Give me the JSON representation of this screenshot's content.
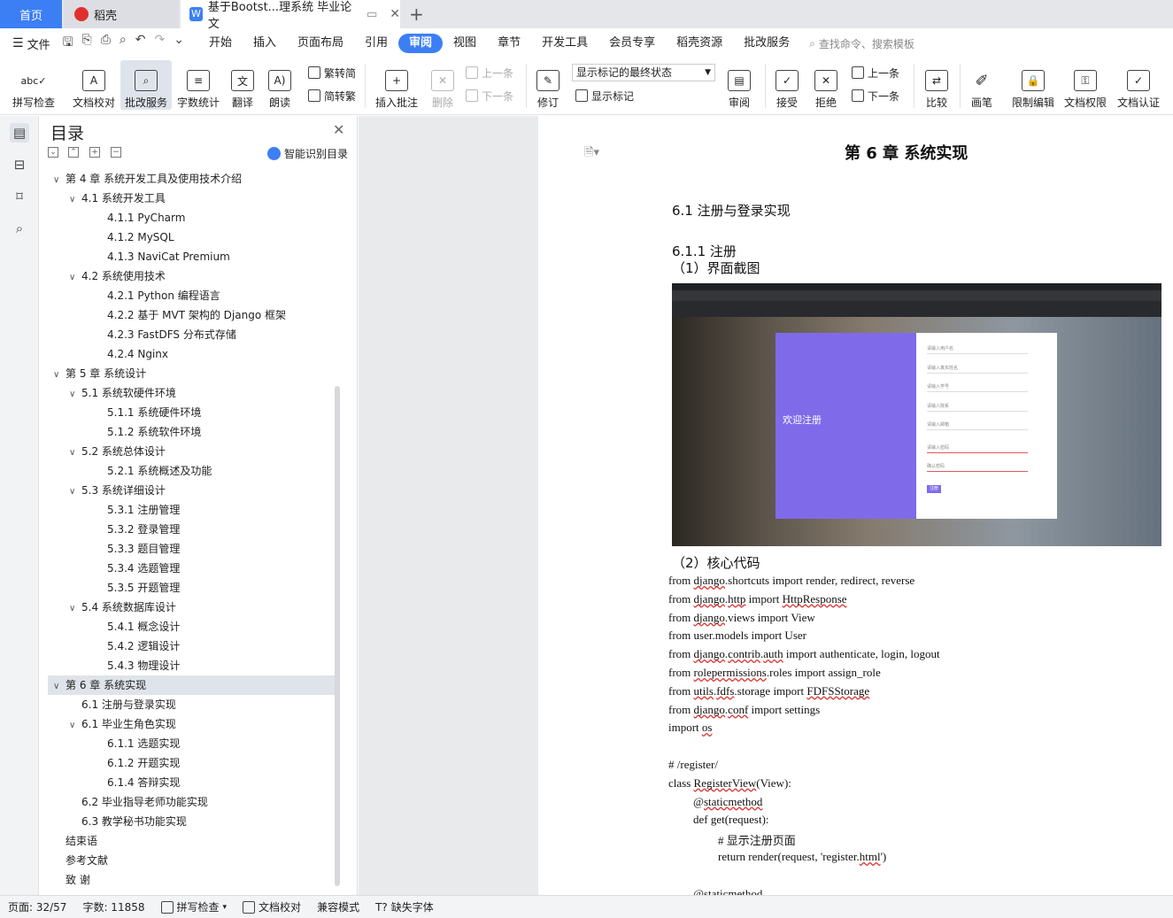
{
  "tabs": {
    "home": "首页",
    "docer": "稻壳",
    "doc": "基于Bootst...理系统 毕业论文"
  },
  "menu": {
    "file": "文件",
    "items": [
      "开始",
      "插入",
      "页面布局",
      "引用",
      "审阅",
      "视图",
      "章节",
      "开发工具",
      "会员专享",
      "稻壳资源",
      "批改服务"
    ],
    "active": "审阅",
    "search": "查找命令、搜索模板"
  },
  "ribbon": {
    "spell": "拼写检查",
    "proof": "文档校对",
    "review_service": "批改服务",
    "wordcount": "字数统计",
    "translate": "翻译",
    "read": "朗读",
    "trad": "繁转简",
    "simp": "简转繁",
    "insert_comment": "插入批注",
    "delete": "删除",
    "prev": "上一条",
    "next": "下一条",
    "track": "修订",
    "markup_state": "显示标记的最终状态",
    "show_markup": "显示标记",
    "review": "审阅",
    "accept": "接受",
    "reject": "拒绝",
    "prev2": "上一条",
    "next2": "下一条",
    "compare": "比较",
    "pen": "画笔",
    "restrict": "限制编辑",
    "perm": "文档权限",
    "cert": "文档认证"
  },
  "toc": {
    "title": "目录",
    "smart": "智能识别目录",
    "items": [
      {
        "t": "第 4 章  系统开发工具及使用技术介绍",
        "l": 0,
        "a": "v"
      },
      {
        "t": "4.1  系统开发工具",
        "l": 1,
        "a": "v"
      },
      {
        "t": "4.1.1 PyCharm",
        "l": 2,
        "a": ""
      },
      {
        "t": "4.1.2 MySQL",
        "l": 2,
        "a": ""
      },
      {
        "t": "4.1.3 NaviCat Premium",
        "l": 2,
        "a": ""
      },
      {
        "t": "4.2  系统使用技术",
        "l": 1,
        "a": "v"
      },
      {
        "t": "4.2.1 Python 编程语言",
        "l": 2,
        "a": ""
      },
      {
        "t": "4.2.2 基于 MVT 架构的 Django 框架",
        "l": 2,
        "a": ""
      },
      {
        "t": "4.2.3 FastDFS 分布式存储",
        "l": 2,
        "a": ""
      },
      {
        "t": "4.2.4 Nginx",
        "l": 2,
        "a": ""
      },
      {
        "t": "第 5 章  系统设计",
        "l": 0,
        "a": "v"
      },
      {
        "t": "5.1 系统软硬件环境",
        "l": 1,
        "a": "v"
      },
      {
        "t": "5.1.1  系统硬件环境",
        "l": 2,
        "a": ""
      },
      {
        "t": "5.1.2  系统软件环境",
        "l": 2,
        "a": ""
      },
      {
        "t": "5.2 系统总体设计",
        "l": 1,
        "a": "v"
      },
      {
        "t": "5.2.1 系统概述及功能",
        "l": 2,
        "a": ""
      },
      {
        "t": "5.3 系统详细设计",
        "l": 1,
        "a": "v"
      },
      {
        "t": "5.3.1  注册管理",
        "l": 2,
        "a": ""
      },
      {
        "t": "5.3.2  登录管理",
        "l": 2,
        "a": ""
      },
      {
        "t": "5.3.3  题目管理",
        "l": 2,
        "a": ""
      },
      {
        "t": "5.3.4  选题管理",
        "l": 2,
        "a": ""
      },
      {
        "t": "5.3.5  开题管理",
        "l": 2,
        "a": ""
      },
      {
        "t": "5.4 系统数据库设计",
        "l": 1,
        "a": "v"
      },
      {
        "t": "5.4.1  概念设计",
        "l": 2,
        "a": ""
      },
      {
        "t": "5.4.2  逻辑设计",
        "l": 2,
        "a": ""
      },
      {
        "t": "5.4.3  物理设计",
        "l": 2,
        "a": ""
      },
      {
        "t": "第 6 章  系统实现",
        "l": 0,
        "a": "v",
        "hl": true
      },
      {
        "t": "6.1  注册与登录实现",
        "l": 1,
        "a": ""
      },
      {
        "t": "6.1 毕业生角色实现",
        "l": 1,
        "a": "v"
      },
      {
        "t": "6.1.1 选题实现",
        "l": 2,
        "a": ""
      },
      {
        "t": "6.1.2  开题实现",
        "l": 2,
        "a": ""
      },
      {
        "t": "6.1.4  答辩实现",
        "l": 2,
        "a": ""
      },
      {
        "t": "6.2  毕业指导老师功能实现",
        "l": 1,
        "a": ""
      },
      {
        "t": "6.3  教学秘书功能实现",
        "l": 1,
        "a": ""
      },
      {
        "t": "结束语",
        "l": 0,
        "a": ""
      },
      {
        "t": "参考文献",
        "l": 0,
        "a": ""
      },
      {
        "t": "致  谢",
        "l": 0,
        "a": ""
      }
    ]
  },
  "doc": {
    "chapter": "第 6 章  系统实现",
    "s61": "6.1  注册与登录实现",
    "s611": "6.1.1  注册",
    "p1": "（1）界面截图",
    "p2": "（2）核心代码",
    "embedded": {
      "welcome": "欢迎注册",
      "fields": [
        "请输入用户名",
        "请输入真实姓名",
        "请输入学号",
        "请输入院系",
        "请输入邮箱",
        "请输入密码",
        "确认密码"
      ],
      "btn": "注册"
    },
    "code": [
      {
        "parts": [
          [
            "from ",
            0
          ],
          [
            "django",
            1
          ],
          [
            ".shortcuts import render, redirect, reverse",
            0
          ]
        ],
        "ind": 0
      },
      {
        "parts": [
          [
            "from ",
            0
          ],
          [
            "django",
            1
          ],
          [
            ".",
            0
          ],
          [
            "http",
            1
          ],
          [
            " import ",
            0
          ],
          [
            "HttpResponse",
            1
          ]
        ],
        "ind": 0
      },
      {
        "parts": [
          [
            "from ",
            0
          ],
          [
            "django",
            1
          ],
          [
            ".views import View",
            0
          ]
        ],
        "ind": 0
      },
      {
        "parts": [
          [
            "from user.models import User",
            0
          ]
        ],
        "ind": 0
      },
      {
        "parts": [
          [
            "from ",
            0
          ],
          [
            "django",
            1
          ],
          [
            ".",
            0
          ],
          [
            "contrib",
            1
          ],
          [
            ".",
            0
          ],
          [
            "auth",
            1
          ],
          [
            " import authenticate,  login, logout",
            0
          ]
        ],
        "ind": 0
      },
      {
        "parts": [
          [
            "from ",
            0
          ],
          [
            "rolepermissions",
            1
          ],
          [
            ".roles import assign_role",
            0
          ]
        ],
        "ind": 0
      },
      {
        "parts": [
          [
            "from ",
            0
          ],
          [
            "utils",
            1
          ],
          [
            ".",
            0
          ],
          [
            "fdfs",
            1
          ],
          [
            ".storage import ",
            0
          ],
          [
            "FDFSStorage",
            1
          ]
        ],
        "ind": 0
      },
      {
        "parts": [
          [
            "from ",
            0
          ],
          [
            "django",
            1
          ],
          [
            ".",
            0
          ],
          [
            "conf",
            1
          ],
          [
            " import settings",
            0
          ]
        ],
        "ind": 0
      },
      {
        "parts": [
          [
            "import ",
            0
          ],
          [
            "os",
            1
          ]
        ],
        "ind": 0
      },
      {
        "parts": [
          [
            "",
            0
          ]
        ],
        "ind": 0
      },
      {
        "parts": [
          [
            "# /register/",
            0
          ]
        ],
        "ind": 0
      },
      {
        "parts": [
          [
            "class ",
            0
          ],
          [
            "RegisterView",
            1
          ],
          [
            "(View):",
            0
          ]
        ],
        "ind": 0
      },
      {
        "parts": [
          [
            "@",
            0
          ],
          [
            "staticmethod",
            1
          ]
        ],
        "ind": 1
      },
      {
        "parts": [
          [
            "def get(request):",
            0
          ]
        ],
        "ind": 1
      },
      {
        "parts": [
          [
            "#  显示注册页面",
            0
          ]
        ],
        "ind": 2
      },
      {
        "parts": [
          [
            "return render(request, 'register.",
            0
          ],
          [
            "html",
            1
          ],
          [
            "')",
            0
          ]
        ],
        "ind": 2
      },
      {
        "parts": [
          [
            "",
            0
          ]
        ],
        "ind": 0
      },
      {
        "parts": [
          [
            "@",
            0
          ],
          [
            "staticmethod",
            1
          ]
        ],
        "ind": 1
      }
    ]
  },
  "status": {
    "page": "页面: 32/57",
    "words": "字数: 11858",
    "spell": "拼写检查",
    "proof": "文档校对",
    "compat": "兼容模式",
    "font": "缺失字体"
  }
}
